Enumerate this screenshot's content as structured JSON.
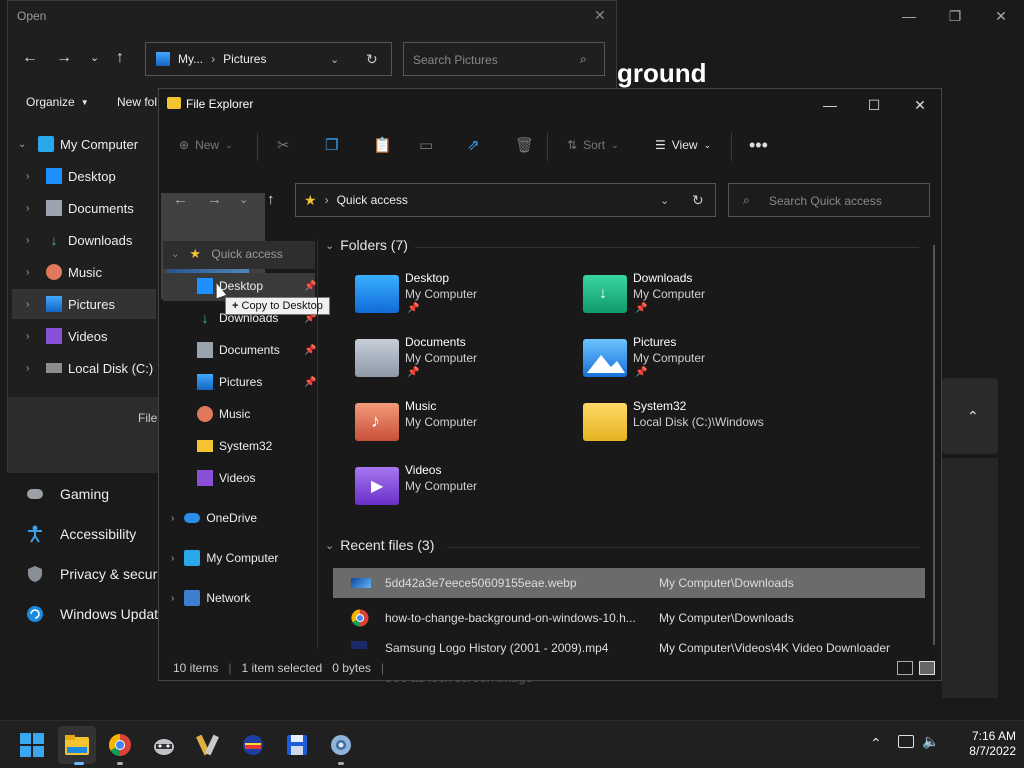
{
  "settings": {
    "heading_partial": "ground",
    "nav": [
      {
        "label": "Gaming",
        "icon": "gamepad-icon"
      },
      {
        "label": "Accessibility",
        "icon": "accessibility-icon"
      },
      {
        "label": "Privacy & securi",
        "icon": "shield-icon"
      },
      {
        "label": "Windows Updat",
        "icon": "update-icon"
      }
    ],
    "bottom_partial": "Use as lock screen image"
  },
  "open_dialog": {
    "title": "Open",
    "breadcrumb": [
      "My...",
      "Pictures"
    ],
    "search_placeholder": "Search Pictures",
    "organize": "Organize",
    "new_folder": "New fol",
    "tree": [
      {
        "label": "My Computer"
      },
      {
        "label": "Desktop"
      },
      {
        "label": "Documents"
      },
      {
        "label": "Downloads"
      },
      {
        "label": "Music"
      },
      {
        "label": "Pictures"
      },
      {
        "label": "Videos"
      },
      {
        "label": "Local Disk (C:)"
      }
    ],
    "file_label": "File"
  },
  "explorer": {
    "title": "File Explorer",
    "toolbar": {
      "new": "New",
      "sort": "Sort",
      "view": "View"
    },
    "address": "Quick access",
    "search_placeholder": "Search Quick access",
    "drag_tooltip": "Copy to Desktop",
    "nav_quick": [
      {
        "label": "Quick access"
      },
      {
        "label": "Desktop"
      },
      {
        "label": "Downloads"
      },
      {
        "label": "Documents"
      },
      {
        "label": "Pictures"
      },
      {
        "label": "Music"
      },
      {
        "label": "System32"
      },
      {
        "label": "Videos"
      }
    ],
    "nav_root": [
      {
        "label": "OneDrive"
      },
      {
        "label": "My Computer"
      },
      {
        "label": "Network"
      }
    ],
    "folders_header": "Folders (7)",
    "folders": [
      {
        "name": "Desktop",
        "location": "My Computer"
      },
      {
        "name": "Downloads",
        "location": "My Computer"
      },
      {
        "name": "Documents",
        "location": "My Computer"
      },
      {
        "name": "Pictures",
        "location": "My Computer"
      },
      {
        "name": "Music",
        "location": "My Computer"
      },
      {
        "name": "System32",
        "location": "Local Disk (C:)\\Windows"
      },
      {
        "name": "Videos",
        "location": "My Computer"
      }
    ],
    "recent_header": "Recent files (3)",
    "recent": [
      {
        "name": "5dd42a3e7eece50609155eae.webp",
        "location": "My Computer\\Downloads"
      },
      {
        "name": "how-to-change-background-on-windows-10.h...",
        "location": "My Computer\\Downloads"
      },
      {
        "name": "Samsung Logo History (2001 - 2009).mp4",
        "location": "My Computer\\Videos\\4K Video Downloader"
      }
    ],
    "status": {
      "items": "10 items",
      "selected": "1 item selected",
      "size": "0 bytes"
    }
  },
  "taskbar": {
    "time": "7:16 AM",
    "date": "8/7/2022"
  }
}
